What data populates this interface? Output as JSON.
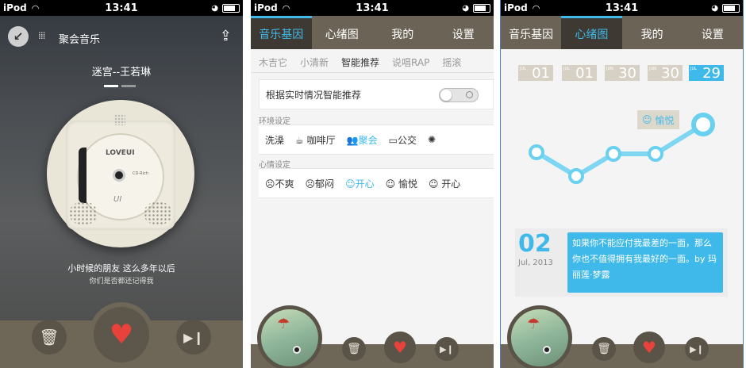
{
  "status": {
    "carrier": "iPod",
    "time": "13:41"
  },
  "player": {
    "back_label": "聚会音乐",
    "song_title": "迷宫--王若琳",
    "disc_brand": "LOVEUI",
    "disc_sub": "CD-Rich",
    "disc_sig": "UI",
    "lyric_line1": "小时候的朋友  这么多年以后",
    "lyric_line2": "你们是否都还记得我"
  },
  "tabs": [
    "音乐基因",
    "心绪图",
    "我的",
    "设置"
  ],
  "gene": {
    "subtabs": [
      "木吉它",
      "小清新",
      "智能推荐",
      "说唱RAP",
      "摇滚"
    ],
    "toggle_label": "根据实时情况智能推荐",
    "env_title": "环境设定",
    "env_items": [
      "洗澡",
      "咖啡厅",
      "聚会",
      "公交"
    ],
    "mood_title": "心情设定",
    "mood_items": [
      "不爽",
      "郁闷",
      "开心",
      "愉悦",
      "开心"
    ]
  },
  "mood_chart": {
    "dates": [
      "01",
      "01",
      "30",
      "30",
      "29"
    ],
    "date_prefix": [
      "JUL",
      "JUL",
      "JUN",
      "JUN",
      "JUL"
    ],
    "tooltip": "愉悦",
    "day": "02",
    "month_year": "Jul, 2013",
    "quote": "如果你不能应付我最差的一面，那么你也不值得拥有我最好的一面。by 玛丽莲·梦露"
  },
  "colors": {
    "accent": "#3fb9e9",
    "heart": "#e8423a",
    "bar": "#6e6657"
  }
}
